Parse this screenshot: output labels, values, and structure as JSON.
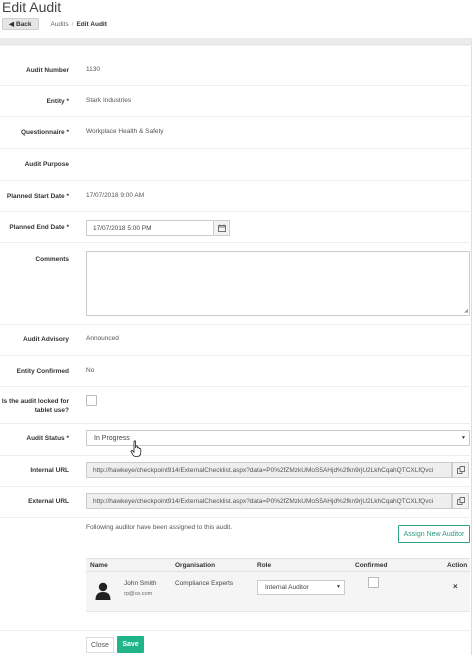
{
  "header": {
    "title": "Edit Audit",
    "back_label": "Back",
    "breadcrumbs": [
      "Audits",
      "Edit Audit"
    ]
  },
  "form": {
    "audit_number": {
      "label": "Audit Number",
      "value": "1130"
    },
    "entity": {
      "label": "Entity *",
      "value": "Stark Industries"
    },
    "questionnaire": {
      "label": "Questionnaire *",
      "value": "Workplace Health & Safety"
    },
    "audit_purpose": {
      "label": "Audit Purpose",
      "value": ""
    },
    "planned_start": {
      "label": "Planned Start Date *",
      "value": "17/07/2018 9:00 AM"
    },
    "planned_end": {
      "label": "Planned End Date *",
      "value": "17/07/2018 5:00 PM"
    },
    "comments": {
      "label": "Comments",
      "value": ""
    },
    "audit_advisory": {
      "label": "Audit Advisory",
      "value": "Announced"
    },
    "entity_confirmed": {
      "label": "Entity Confirmed",
      "value": "No"
    },
    "locked": {
      "label_line1": "Is the audit locked for",
      "label_line2": "tablet use?",
      "checked": false
    },
    "audit_status": {
      "label": "Audit Status *",
      "value": "In Progress"
    },
    "internal_url": {
      "label": "Internal URL",
      "value": "http://hawkeye/checkpoint914/ExternalChecklist.aspx?data=P0%2fZMzkUMoS5AHjd%2fkn9rjU2LkhCqahQTCXLfQvci"
    },
    "external_url": {
      "label": "External URL",
      "value": "http://hawkeye/checkpoint914/ExternalChecklist.aspx?data=P0%2fZMzkUMoS5AHjd%2fkn9rjU2LkhCqahQTCXLfQvci"
    }
  },
  "auditors": {
    "intro": "Following auditor have been assigned to this audit.",
    "assign_label": "Assign New Auditor",
    "columns": [
      "Name",
      "Organisation",
      "Role",
      "Confirmed",
      "Action"
    ],
    "rows": [
      {
        "name": "John Smith",
        "email": "rp@ce.com",
        "organisation": "Compliance Experts",
        "role": "Internal Auditor",
        "confirmed": false
      }
    ]
  },
  "footer": {
    "close_label": "Close",
    "save_label": "Save"
  },
  "icons": {
    "calendar": "calendar-icon",
    "copy": "copy-icon",
    "remove": "×",
    "caret": "▼"
  },
  "colors": {
    "accent": "#1fb589",
    "assign_border": "#2fa58a"
  }
}
